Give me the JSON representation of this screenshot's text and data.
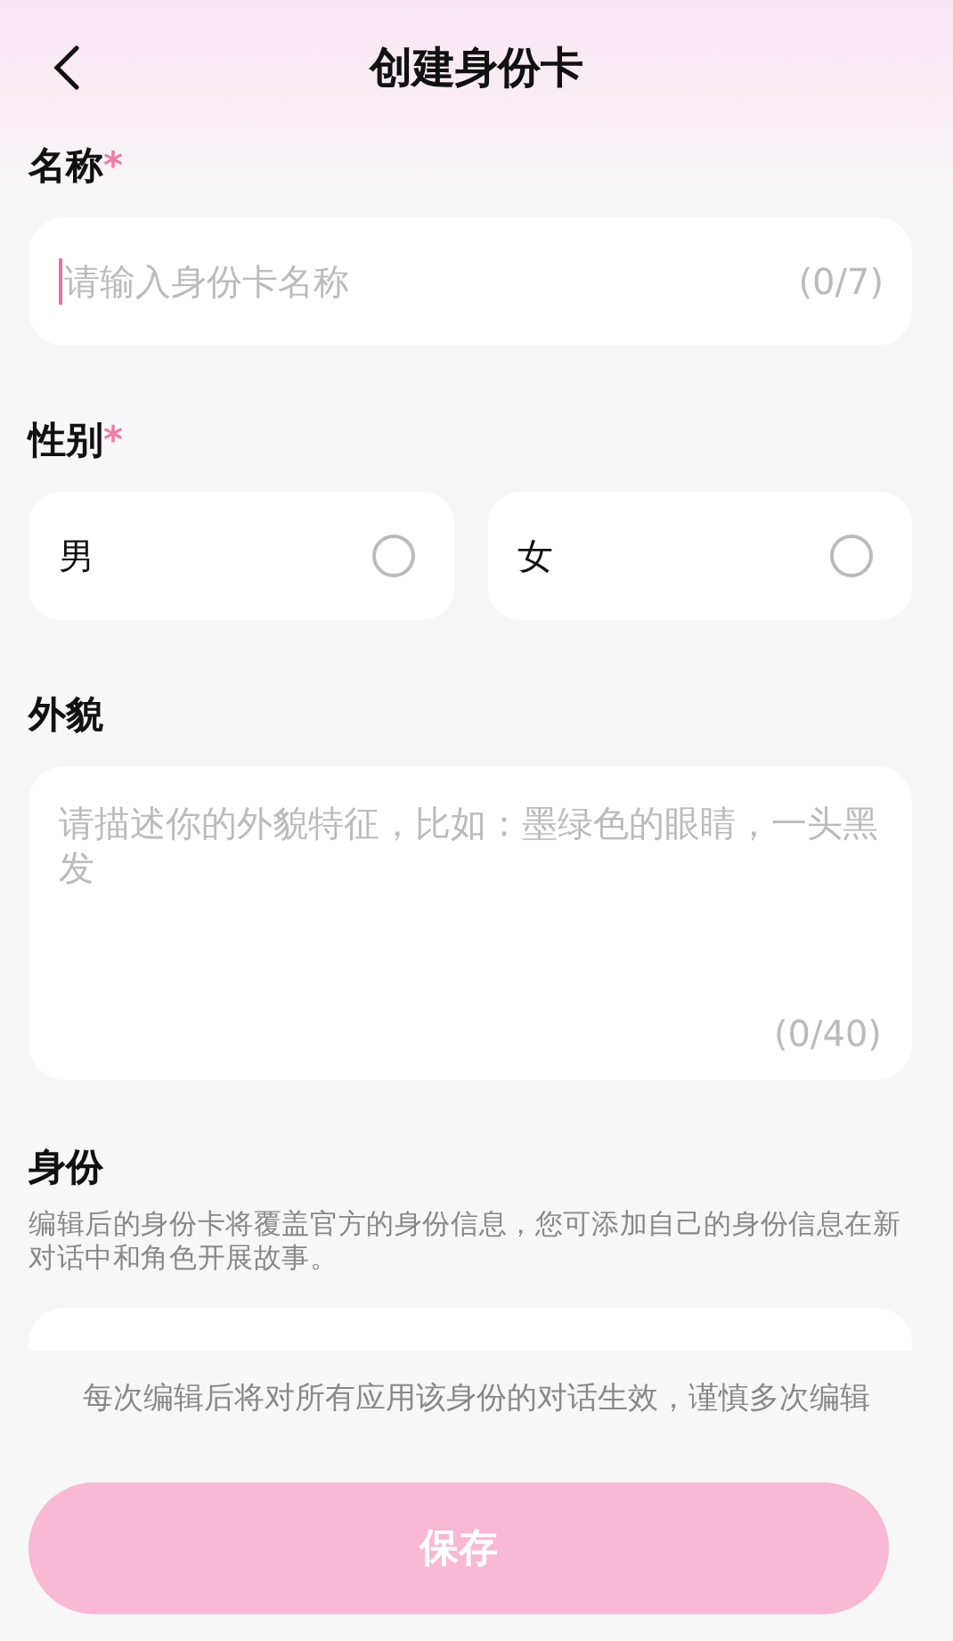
{
  "header": {
    "title": "创建身份卡"
  },
  "name_field": {
    "label": "名称",
    "required_mark": "*",
    "placeholder": "请输入身份卡名称",
    "counter": "(0/7)"
  },
  "gender": {
    "label": "性别",
    "required_mark": "*",
    "options": [
      {
        "label": "男",
        "selected": false
      },
      {
        "label": "女",
        "selected": false
      }
    ]
  },
  "appearance": {
    "label": "外貌",
    "placeholder": "请描述你的外貌特征，比如：墨绿色的眼睛，一头黑发",
    "counter": "(0/40)"
  },
  "identity": {
    "label": "身份",
    "description": "编辑后的身份卡将覆盖官方的身份信息，您可添加自己的身份信息在新对话中和角色开展故事。"
  },
  "footer": {
    "notice": "每次编辑后将对所有应用该身份的对话生效，谨慎多次编辑",
    "save_button": "保存",
    "save_disabled": true
  }
}
